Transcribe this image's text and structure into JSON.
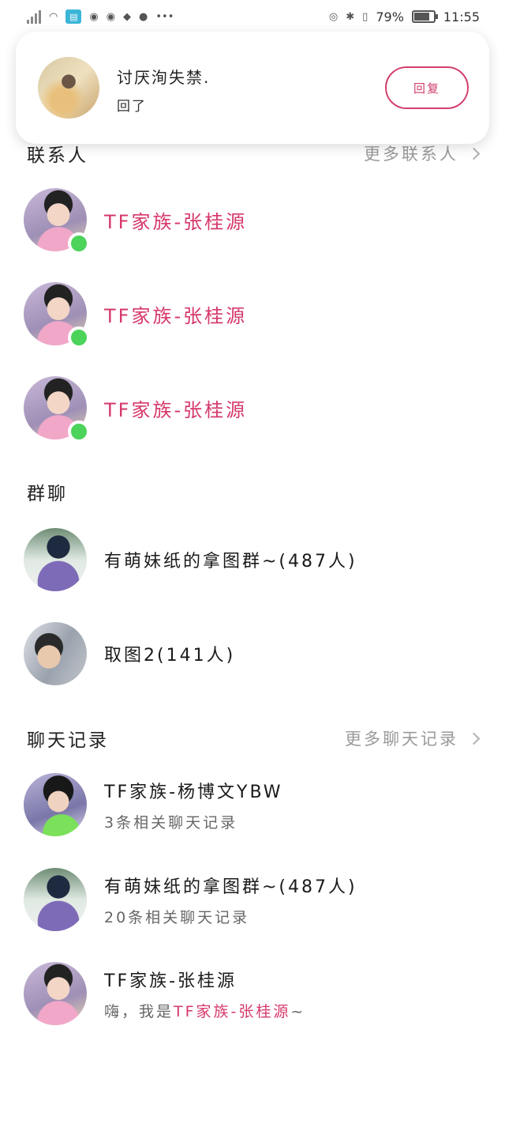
{
  "status_bar": {
    "battery_percent": "79%",
    "battery_level": 0.79,
    "time": "11:55",
    "icons": [
      "signal-icon",
      "wifi-icon",
      "app-book-icon",
      "notification-dot-icon",
      "notification-dot-icon",
      "diamond-icon",
      "wechat-icon",
      "more-icon",
      "eye-icon",
      "bluetooth-icon",
      "vibrate-icon",
      "battery-icon"
    ]
  },
  "notification": {
    "name": "讨厌洵失禁.",
    "message": "回了",
    "reply_label": "回复"
  },
  "contacts_section": {
    "title": "联系人",
    "more_label": "更多联系人",
    "items": [
      {
        "name": "TF家族-张桂源",
        "online": true
      },
      {
        "name": "TF家族-张桂源",
        "online": true
      },
      {
        "name": "TF家族-张桂源",
        "online": true
      }
    ]
  },
  "groups_section": {
    "title": "群聊",
    "items": [
      {
        "name": "有萌妹纸的拿图群~(487人)"
      },
      {
        "name": "取图2(141人)"
      }
    ]
  },
  "history_section": {
    "title": "聊天记录",
    "more_label": "更多聊天记录",
    "items": [
      {
        "name": "TF家族-杨博文YBW",
        "detail": "3条相关聊天记录"
      },
      {
        "name": "有萌妹纸的拿图群~(487人)",
        "detail": "20条相关聊天记录"
      },
      {
        "name": "TF家族-张桂源",
        "detail_prefix": "嗨，我是",
        "detail_highlight": "TF家族-张桂源",
        "detail_suffix": "~"
      }
    ]
  },
  "colors": {
    "accent": "#d6386a",
    "online": "#4cd35a",
    "muted": "#9a9a9a"
  }
}
